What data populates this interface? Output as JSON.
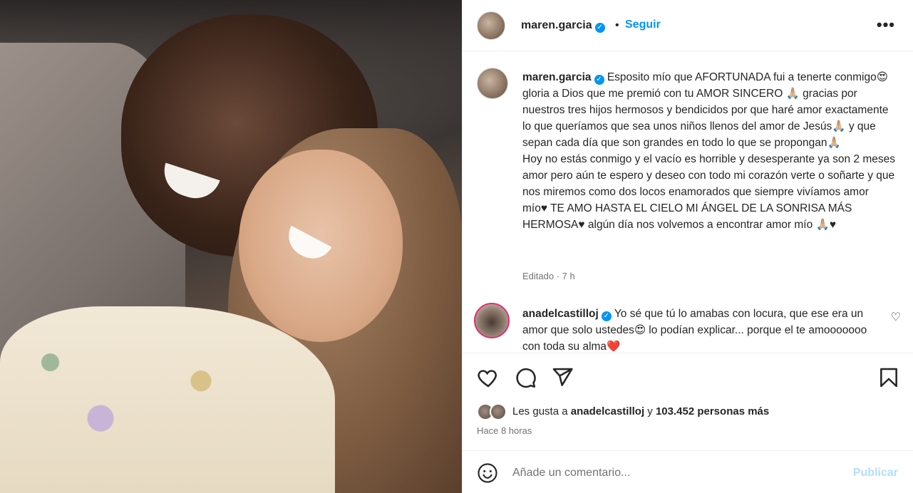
{
  "post": {
    "username": "maren.garcia",
    "follow_label": "Seguir",
    "dot": "•",
    "more_label": "•••",
    "caption_text": "Esposito mío que AFORTUNADA fui a tenerte conmigo😍 gloria a Dios que me premió con tu AMOR SINCERO 🙏🏼 gracias por nuestros tres hijos hermosos y bendicidos por que haré amor exactamente lo que queríamos que sea unos niños llenos del amor de Jesús🙏🏼 y que sepan cada día que son grandes en todo lo que se propongan🙏🏼\nHoy no estás conmigo y el vacío es horrible y desesperante ya son 2 meses amor pero aún te espero y deseo con todo mi corazón verte o soñarte y que nos miremos como dos locos enamorados que siempre vivíamos amor mío♥ TE AMO HASTA EL CIELO MI ÁNGEL DE LA SONRISA MÁS HERMOSA♥ algún día nos volvemos a encontrar amor mío 🙏🏼♥",
    "caption_meta": "Editado · 7 h"
  },
  "comment": {
    "username": "anadelcastilloj",
    "text": "Yo sé que tú lo amabas con locura, que ese era un amor que solo ustedes😍 lo podían explicar... porque el te amooooooo con toda su alma❤️"
  },
  "likes": {
    "prefix": "Les gusta a ",
    "user": "anadelcastilloj",
    "middle": " y ",
    "count": "103.452 personas más"
  },
  "time_ago": "Hace 8 horas",
  "add_comment": {
    "placeholder": "Añade un comentario...",
    "post_label": "Publicar"
  },
  "icons": {
    "verified": "verified-badge-icon",
    "like": "heart-icon",
    "comment": "comment-bubble-icon",
    "share": "send-icon",
    "save": "bookmark-icon",
    "emoji": "smiley-icon"
  },
  "colors": {
    "accent": "#0095f6",
    "text": "#262626",
    "muted": "#737373",
    "publish_disabled": "#b2dffc"
  }
}
